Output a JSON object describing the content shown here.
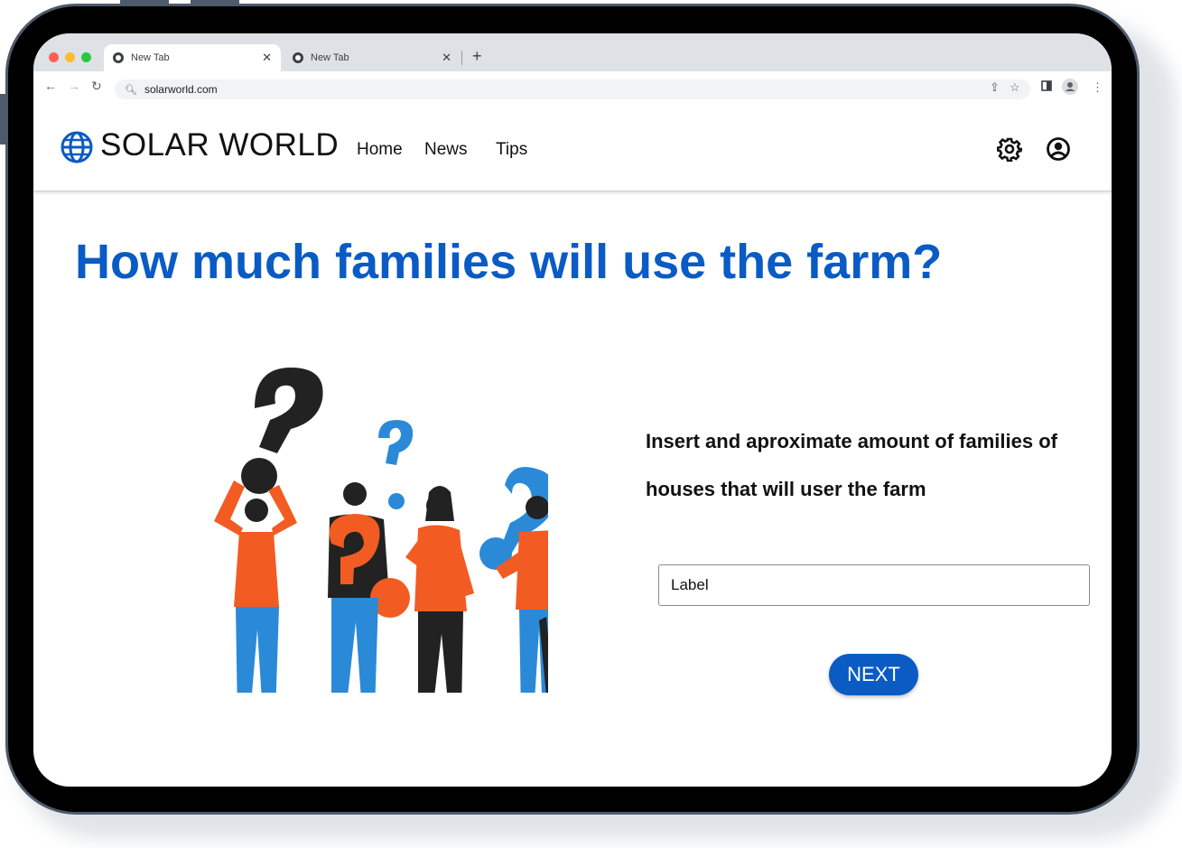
{
  "browser": {
    "tabs": [
      {
        "title": "New Tab",
        "active": true
      },
      {
        "title": "New Tab",
        "active": false
      }
    ],
    "url": "solarworld.com"
  },
  "site": {
    "brand": "SOLAR WORLD",
    "nav": [
      "Home",
      "News",
      "Tips"
    ]
  },
  "main": {
    "headline": "How much families will use the farm?",
    "prompt": "Insert and aproximate amount of families of houses that will user the farm",
    "input_label": "Label",
    "next_label": "NEXT"
  },
  "colors": {
    "accent": "#0a5bc4",
    "orange": "#f25c22",
    "blue": "#2a8ad8",
    "dark": "#222222"
  }
}
